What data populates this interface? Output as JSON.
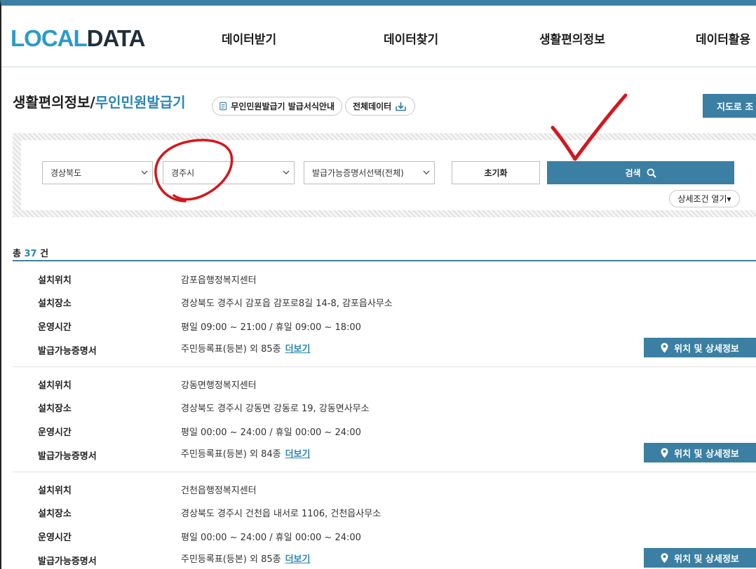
{
  "header": {
    "logo_part1": "LOCAL",
    "logo_part2": "DATA",
    "nav": [
      "데이터받기",
      "데이터찾기",
      "생활편의정보",
      "데이터활용"
    ]
  },
  "title": {
    "main": "생활편의정보/",
    "sub": "무인민원발급기"
  },
  "buttons": {
    "guide": "무인민원발급기 발급서식안내",
    "full_data": "전체데이터",
    "map_view": "지도로 조"
  },
  "search": {
    "province": "경상북도",
    "city": "경주시",
    "certificate": "발급가능증명서선택(전체)",
    "reset": "초기화",
    "search": "검색",
    "detail_toggle": "상세조건 열기▾"
  },
  "total": {
    "prefix": "총",
    "count": "37",
    "suffix": "건"
  },
  "labels": {
    "location": "설치위치",
    "place": "설치장소",
    "hours": "운영시간",
    "certs": "발급가능증명서",
    "more": "더보기",
    "detail_button": "위치 및 상세정보"
  },
  "results": [
    {
      "location": "감포읍행정복지센터",
      "place": "경상북도 경주시 감포읍 감포로8길 14-8, 감포읍사무소",
      "hours": "평일 09:00 ~ 21:00 / 휴일 09:00 ~ 18:00",
      "certs": "주민등록표(등본) 외 85종"
    },
    {
      "location": "강동면행정복지센터",
      "place": "경상북도 경주시 강동면 강동로 19, 강동면사무소",
      "hours": "평일 00:00 ~ 24:00 / 휴일 00:00 ~ 24:00",
      "certs": "주민등록표(등본) 외 84종"
    },
    {
      "location": "건천읍행정복지센터",
      "place": "경상북도 경주시 건천읍 내서로 1106, 건천읍사무소",
      "hours": "평일 00:00 ~ 24:00 / 휴일 00:00 ~ 24:00",
      "certs": "주민등록표(등본) 외 85종"
    }
  ],
  "colors": {
    "accent": "#3b7fa3",
    "logo_blue": "#2a9bc9",
    "annotation_red": "#d4161c"
  }
}
